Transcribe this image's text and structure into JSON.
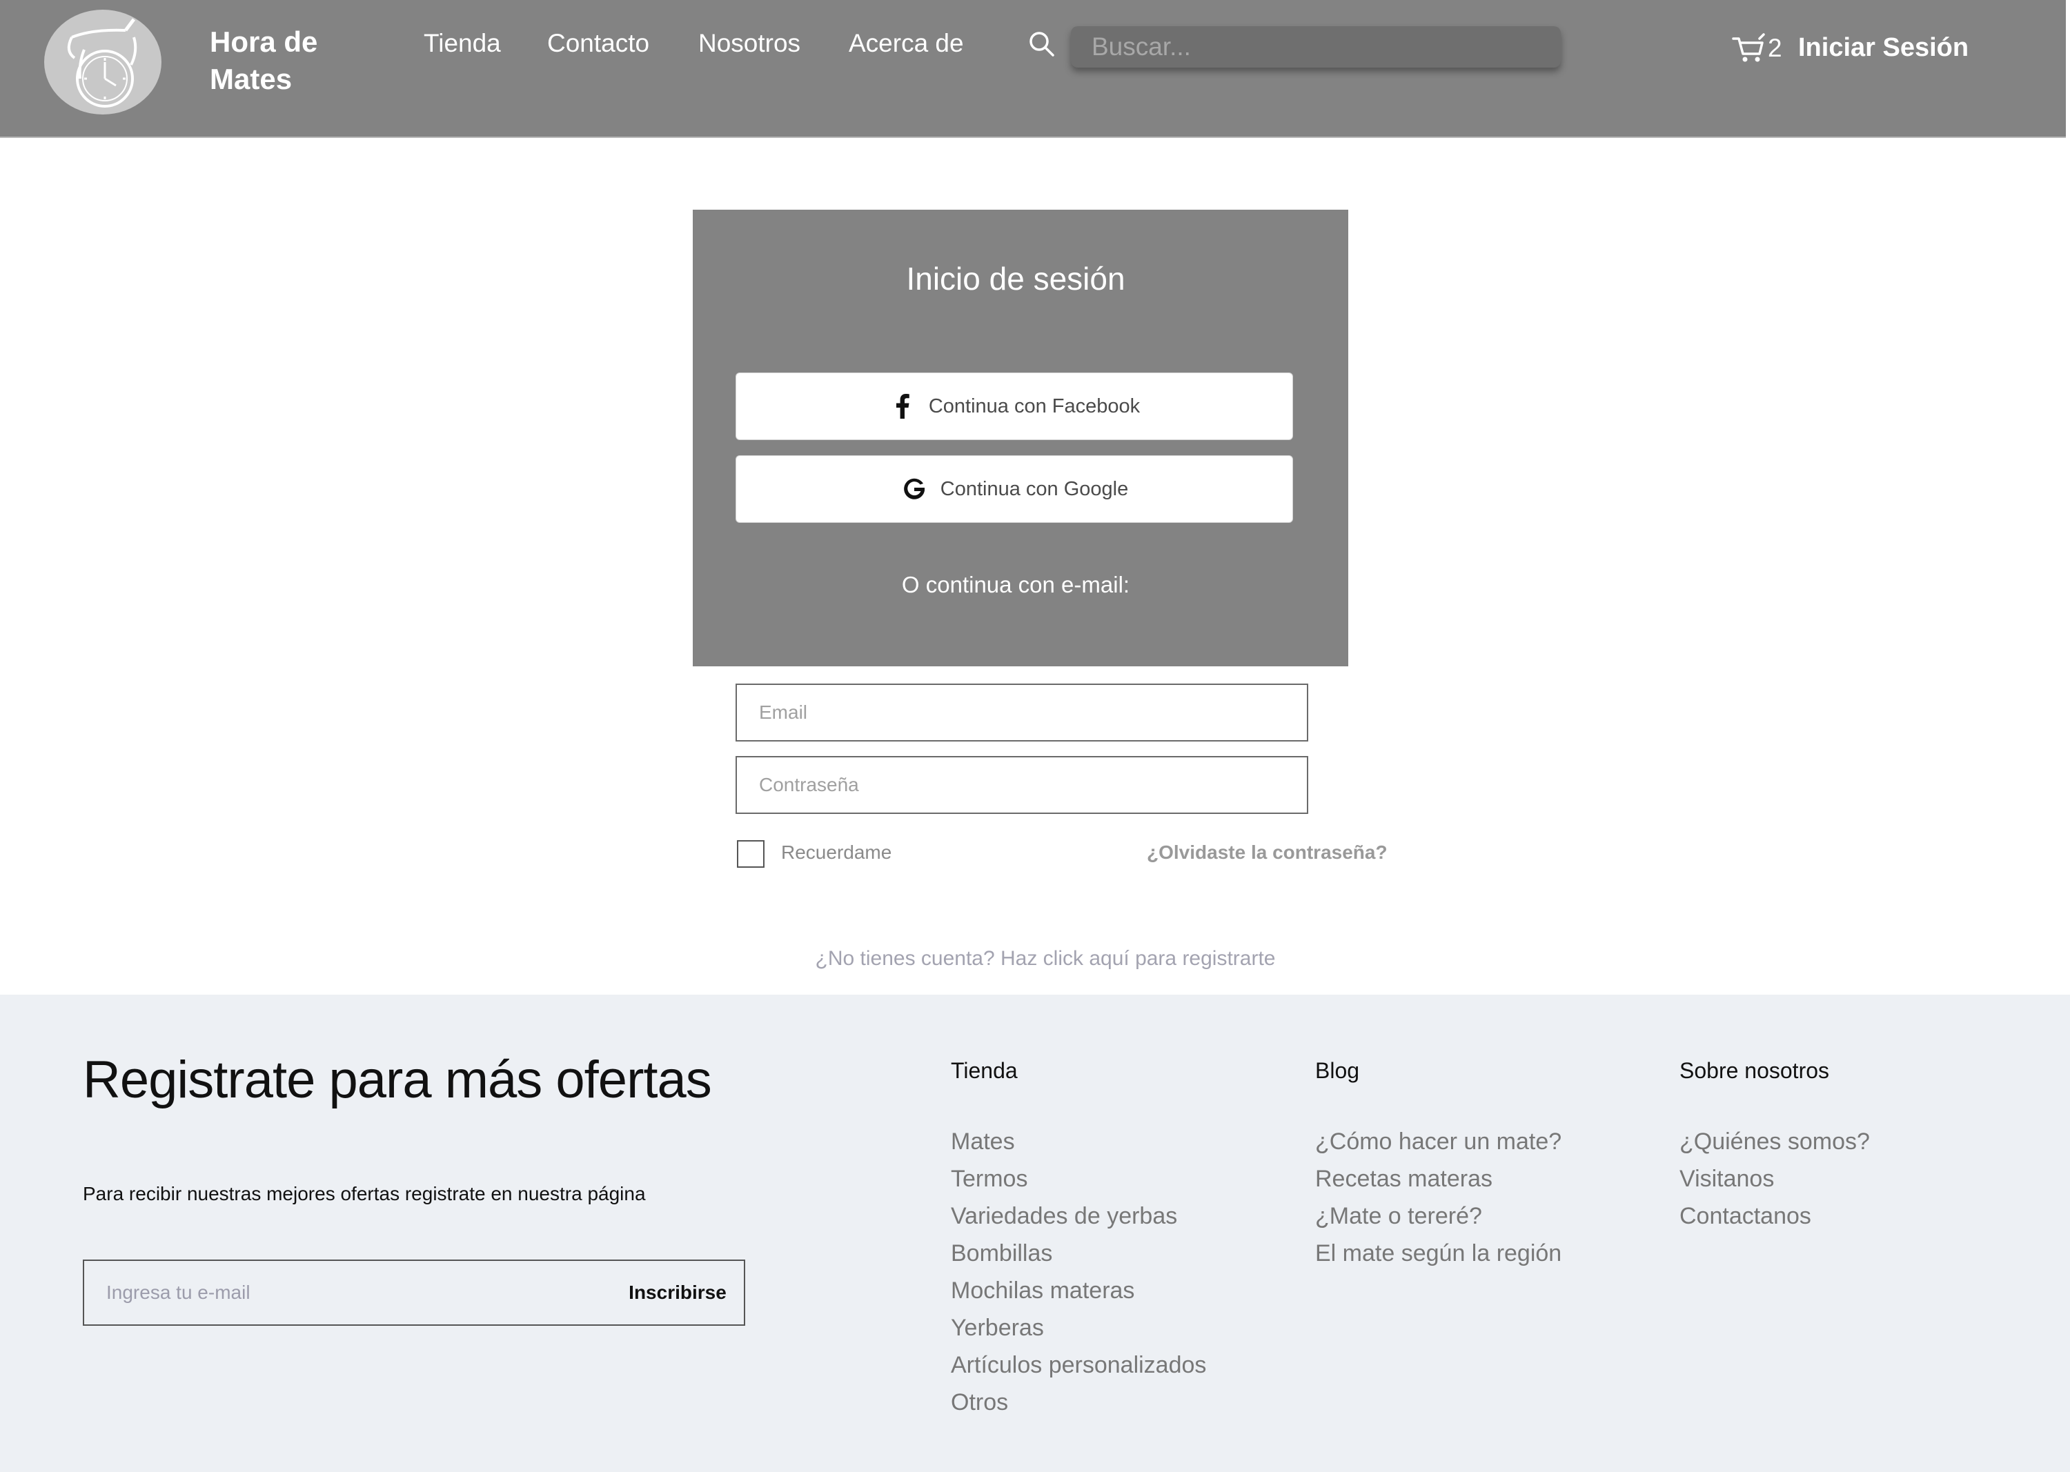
{
  "header": {
    "brand_line1": "Hora de",
    "brand_line2": "Mates",
    "nav": [
      "Tienda",
      "Contacto",
      "Nosotros",
      "Acerca de"
    ],
    "search_placeholder": "Buscar...",
    "cart_count": "2",
    "login_label": "Iniciar Sesión",
    "icons": {
      "search": "search-icon",
      "cart": "cart-icon",
      "logo": "mate-clock-logo"
    }
  },
  "login": {
    "title": "Inicio de sesión",
    "facebook_label": "Continua con Facebook",
    "google_label": "Continua con Google",
    "or_label": "O continua con e-mail:",
    "email_placeholder": "Email",
    "password_placeholder": "Contraseña",
    "remember_label": "Recuerdame",
    "forgot_label": "¿Olvidaste la contraseña?",
    "register_label": "¿No tienes cuenta? Haz click aquí para registrarte"
  },
  "footer": {
    "heading": "Registrate para más ofertas",
    "subtext": "Para recibir nuestras mejores ofertas registrate en nuestra página",
    "newsletter_placeholder": "Ingresa tu e-mail",
    "subscribe_label": "Inscribirse",
    "columns": [
      {
        "title": "Tienda",
        "items": [
          "Mates",
          "Termos",
          "Variedades de yerbas",
          "Bombillas",
          "Mochilas materas",
          "Yerberas",
          "Artículos personalizados",
          "Otros"
        ]
      },
      {
        "title": "Blog",
        "items": [
          "¿Cómo hacer un mate?",
          "Recetas materas",
          "¿Mate o tereré?",
          "El mate según la región"
        ]
      },
      {
        "title": "Sobre nosotros",
        "items": [
          "¿Quiénes somos?",
          "Visitanos",
          "Contactanos"
        ]
      }
    ]
  },
  "colors": {
    "header_bg": "#838383",
    "card_bg": "#838383",
    "footer_bg": "#edf0f4",
    "link_muted": "#777777"
  }
}
